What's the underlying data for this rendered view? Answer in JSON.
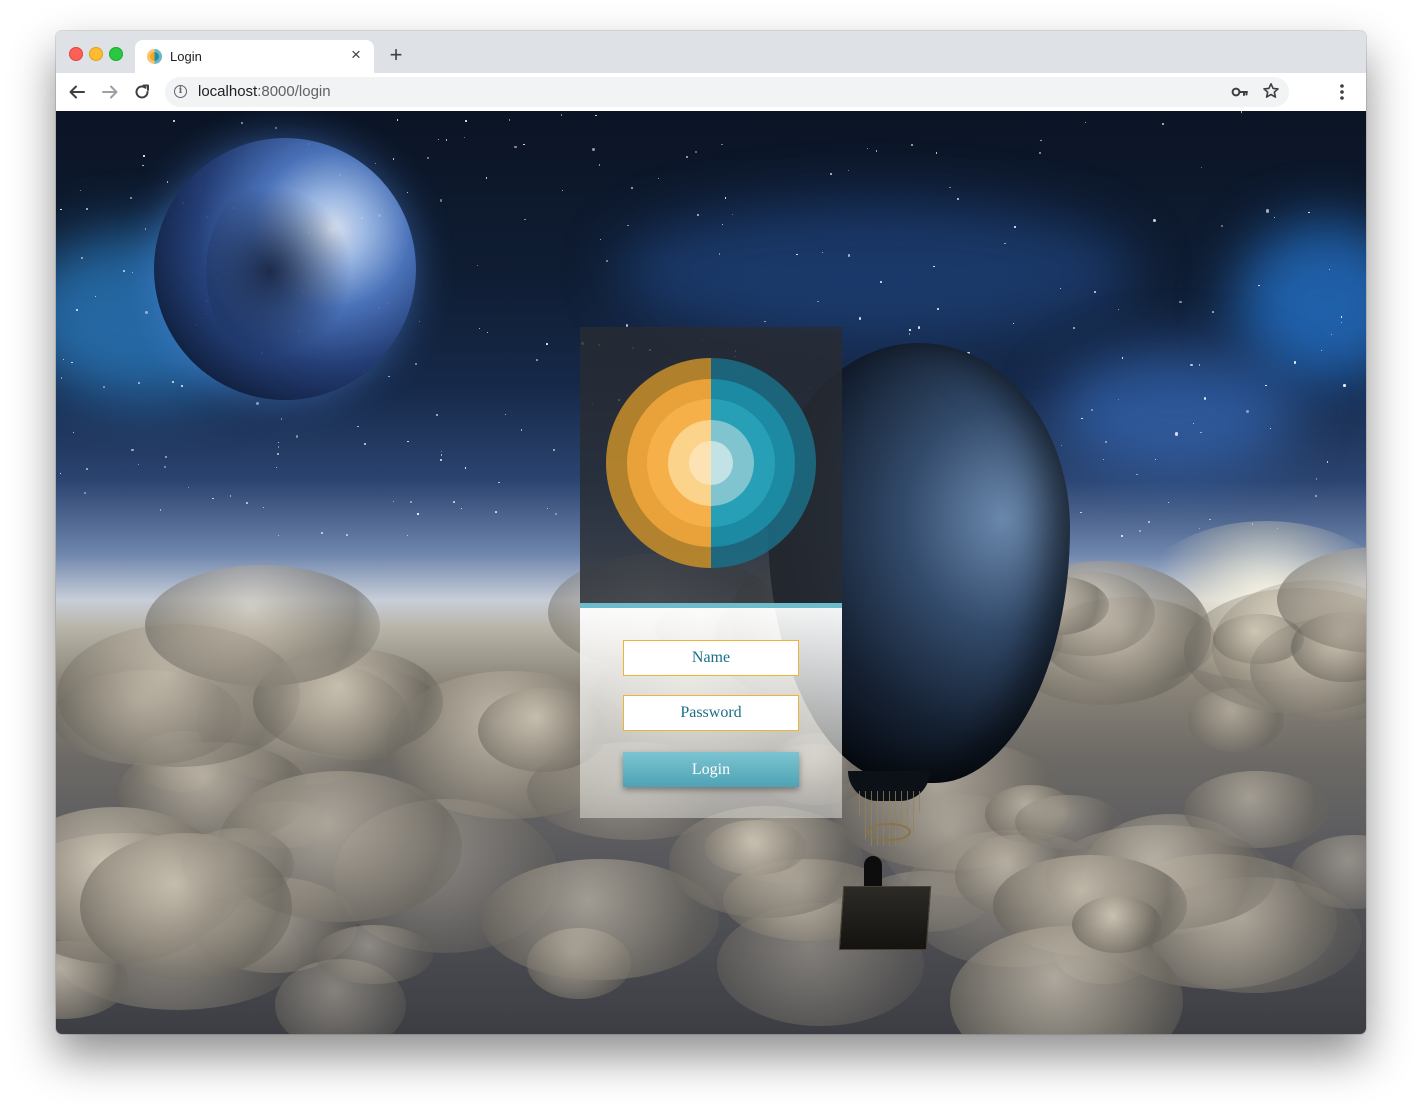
{
  "browser": {
    "tab": {
      "title": "Login",
      "close_glyph": "×"
    },
    "new_tab_glyph": "+",
    "url": {
      "host": "localhost",
      "rest": ":8000/login"
    },
    "icons": {
      "back": "arrow-left-icon",
      "forward": "arrow-right-icon",
      "reload": "reload-icon",
      "info": "info-icon",
      "key": "key-icon",
      "star": "star-icon",
      "menu": "kebab-menu-icon"
    },
    "info_glyph": "i"
  },
  "login": {
    "name_placeholder": "Name",
    "password_placeholder": "Password",
    "login_label": "Login",
    "colors": {
      "accent_orange": "#f5a623",
      "accent_teal": "#1e8fa8",
      "divider": "#6cbccc",
      "button": "#5eb0c1",
      "field_border": "#f0b33a",
      "field_text": "#1a6f86"
    }
  }
}
